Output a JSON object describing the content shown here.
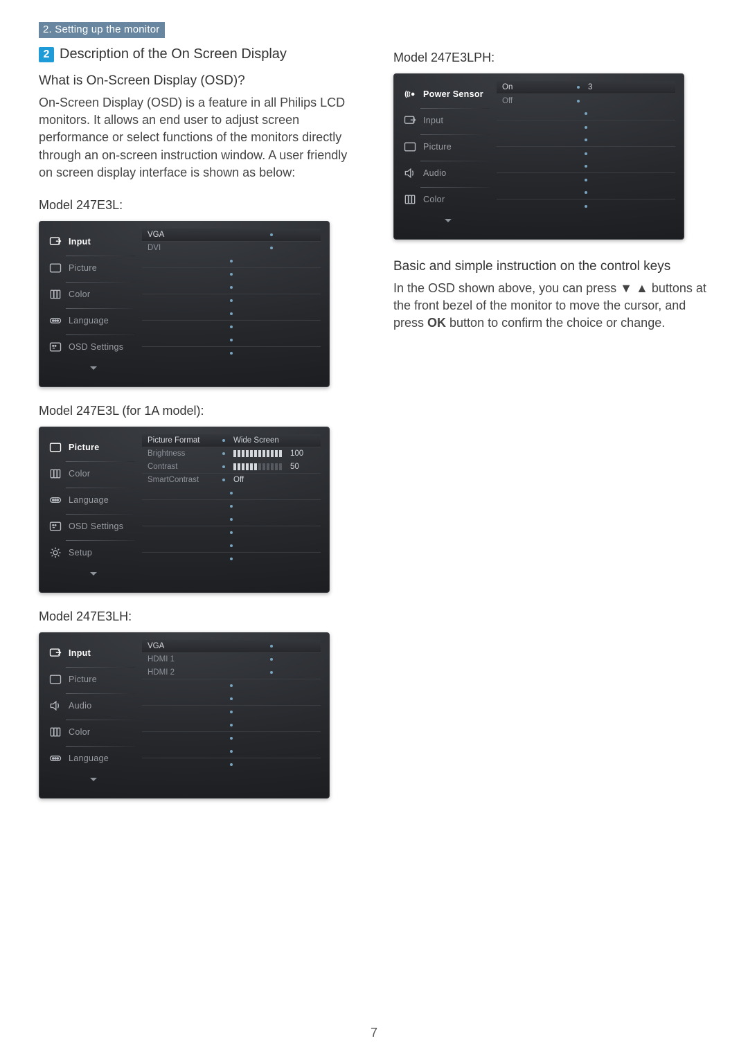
{
  "section_tag": "2. Setting up the monitor",
  "section_number": "2",
  "section_title": "Description of the On Screen Display",
  "q1": "What is On-Screen Display (OSD)?",
  "intro": "On-Screen Display (OSD) is a feature in all Philips LCD monitors. It allows an end user to adjust screen performance or select functions of the monitors directly through an on-screen instruction window. A user friendly on screen display interface is shown as below:",
  "model1_label": "Model 247E3L:",
  "model2_label": "Model 247E3L (for 1A model):",
  "model3_label": "Model 247E3LH:",
  "model4_label": "Model 247E3LPH:",
  "basic_heading": "Basic and simple instruction on the control keys",
  "basic_body_1": "In the OSD shown above, you can press ▼ ▲ buttons at the front bezel of the monitor to move the cursor, and press ",
  "basic_body_ok": "OK",
  "basic_body_2": " button to confirm the choice or change.",
  "page_num": "7",
  "osd1": {
    "items": [
      {
        "icon": "input",
        "label": "Input",
        "active": true,
        "subs": [
          "VGA",
          "DVI"
        ]
      },
      {
        "icon": "picture",
        "label": "Picture",
        "subs": [
          "",
          ""
        ]
      },
      {
        "icon": "color",
        "label": "Color",
        "subs": [
          "",
          ""
        ]
      },
      {
        "icon": "language",
        "label": "Language",
        "subs": [
          "",
          ""
        ]
      },
      {
        "icon": "osd",
        "label": "OSD Settings",
        "subs": [
          "",
          ""
        ]
      }
    ]
  },
  "osd2": {
    "items": [
      {
        "icon": "picture",
        "label": "Picture",
        "active": true,
        "subs2": [
          {
            "label": "Picture Format",
            "value": "Wide Screen"
          },
          {
            "label": "Brightness",
            "slider": 100,
            "valnum": "100"
          }
        ]
      },
      {
        "icon": "color",
        "label": "Color",
        "subs2": [
          {
            "label": "Contrast",
            "slider": 50,
            "valnum": "50"
          },
          {
            "label": "SmartContrast",
            "value": "Off"
          }
        ]
      },
      {
        "icon": "language",
        "label": "Language",
        "subs": [
          "",
          ""
        ]
      },
      {
        "icon": "osd",
        "label": "OSD Settings",
        "subs": [
          "",
          ""
        ]
      },
      {
        "icon": "setup",
        "label": "Setup",
        "subs": [
          "",
          ""
        ]
      }
    ]
  },
  "osd3": {
    "items": [
      {
        "icon": "input",
        "label": "Input",
        "active": true,
        "subs": [
          "VGA",
          "HDMI 1"
        ]
      },
      {
        "icon": "picture",
        "label": "Picture",
        "subs": [
          "HDMI 2",
          ""
        ]
      },
      {
        "icon": "audio",
        "label": "Audio",
        "subs": [
          "",
          ""
        ]
      },
      {
        "icon": "color",
        "label": "Color",
        "subs": [
          "",
          ""
        ]
      },
      {
        "icon": "language",
        "label": "Language",
        "subs": [
          "",
          ""
        ]
      }
    ]
  },
  "osd4": {
    "items": [
      {
        "icon": "power",
        "label": "Power Sensor",
        "active": true,
        "subs2": [
          {
            "label": "On",
            "value": "3"
          },
          {
            "label": "Off",
            "value": ""
          }
        ]
      },
      {
        "icon": "input",
        "label": "Input",
        "subs": [
          "",
          ""
        ]
      },
      {
        "icon": "picture",
        "label": "Picture",
        "subs": [
          "",
          ""
        ]
      },
      {
        "icon": "audio",
        "label": "Audio",
        "subs": [
          "",
          ""
        ]
      },
      {
        "icon": "color",
        "label": "Color",
        "subs": [
          "",
          ""
        ]
      }
    ]
  }
}
